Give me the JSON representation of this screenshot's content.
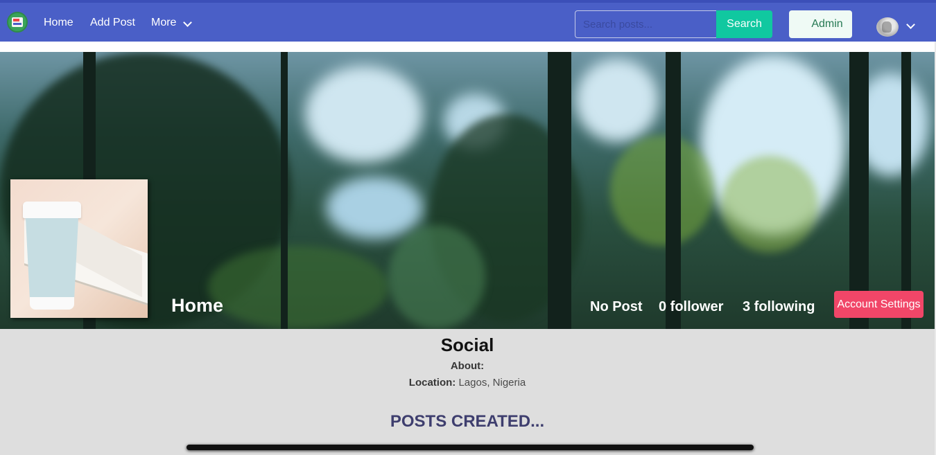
{
  "navbar": {
    "links": [
      "Home",
      "Add Post",
      "More"
    ],
    "search": {
      "placeholder": "Search posts...",
      "button": "Search"
    },
    "admin_label": "Admin"
  },
  "profile": {
    "banner_title": "Home",
    "stats": {
      "posts": "No Post",
      "followers": "0 follower",
      "following": "3 following"
    },
    "account_settings": "Account Settings",
    "name": "Social",
    "about_label": "About:",
    "location_label": "Location:",
    "location": "Lagos, Nigeria"
  },
  "posts_section": {
    "title": "POSTS CREATED..."
  },
  "colors": {
    "navbar": "#4a5fc7",
    "search_button": "#10c8a0",
    "account_settings": "#f14668",
    "posts_title": "#3e3e6e"
  },
  "icons": [
    "app-logo-icon",
    "chevron-down-icon",
    "user-avatar-icon"
  ]
}
